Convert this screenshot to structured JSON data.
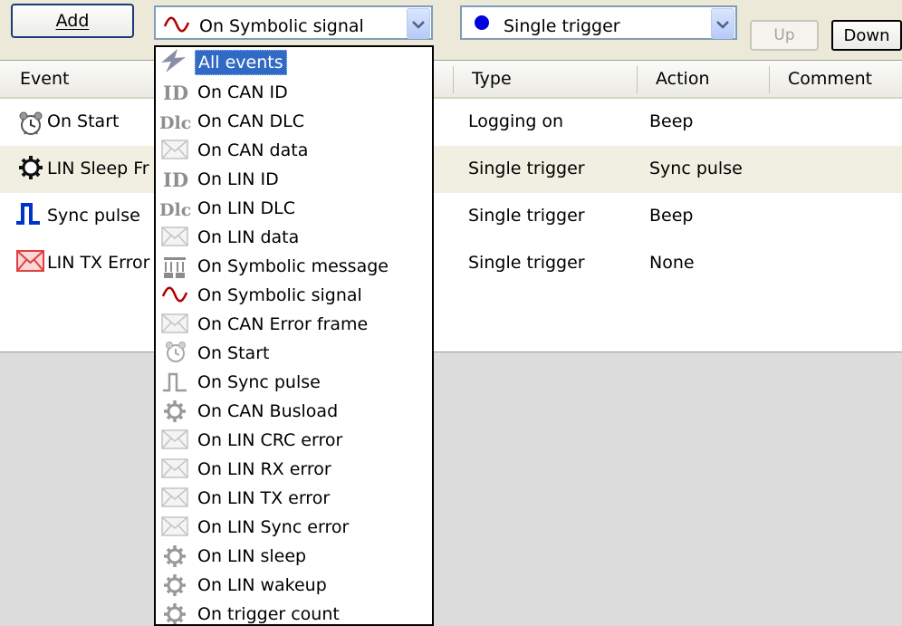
{
  "toolbar": {
    "add_label": "Add",
    "event_combo": {
      "selected": "On Symbolic signal",
      "icon": "sine-wave-icon"
    },
    "type_combo": {
      "selected": "Single trigger",
      "icon": "blue-dot-icon"
    },
    "up_label": "Up",
    "down_label": "Down"
  },
  "table": {
    "columns": {
      "event": "Event",
      "type": "Type",
      "action": "Action",
      "comment": "Comment"
    },
    "rows": [
      {
        "event": "On Start",
        "type": "Logging on",
        "action": "Beep",
        "comment": "",
        "icon": "alarm-clock-icon"
      },
      {
        "event": "LIN Sleep Fr",
        "type": "Single trigger",
        "action": "Sync pulse",
        "comment": "",
        "icon": "gear-icon"
      },
      {
        "event": "Sync pulse",
        "type": "Single trigger",
        "action": "Beep",
        "comment": "",
        "icon": "pulse-icon"
      },
      {
        "event": "LIN TX Error",
        "type": "Single trigger",
        "action": "None",
        "comment": "",
        "icon": "envelope-icon"
      }
    ]
  },
  "dropdown": {
    "items": [
      {
        "label": "All events",
        "icon": "lightning-icon",
        "selected": true
      },
      {
        "label": "On CAN ID",
        "icon": "id-icon"
      },
      {
        "label": "On CAN DLC",
        "icon": "dlc-icon"
      },
      {
        "label": "On CAN data",
        "icon": "envelope-icon"
      },
      {
        "label": "On LIN ID",
        "icon": "id-icon"
      },
      {
        "label": "On LIN DLC",
        "icon": "dlc-icon"
      },
      {
        "label": "On LIN data",
        "icon": "envelope-icon"
      },
      {
        "label": "On Symbolic message",
        "icon": "message-icon"
      },
      {
        "label": "On Symbolic signal",
        "icon": "sine-wave-icon"
      },
      {
        "label": "On CAN Error frame",
        "icon": "envelope-icon"
      },
      {
        "label": "On Start",
        "icon": "alarm-clock-icon"
      },
      {
        "label": "On Sync pulse",
        "icon": "pulse-icon"
      },
      {
        "label": "On CAN Busload",
        "icon": "gear-icon"
      },
      {
        "label": "On LIN CRC error",
        "icon": "envelope-icon"
      },
      {
        "label": "On LIN RX error",
        "icon": "envelope-icon"
      },
      {
        "label": "On LIN TX error",
        "icon": "envelope-icon"
      },
      {
        "label": "On LIN Sync error",
        "icon": "envelope-icon"
      },
      {
        "label": "On LIN sleep",
        "icon": "gear-icon"
      },
      {
        "label": "On LIN wakeup",
        "icon": "gear-icon"
      },
      {
        "label": "On trigger count",
        "icon": "gear-icon"
      }
    ]
  },
  "colors": {
    "selection": "#316ac5",
    "row_highlight": "#f1efe2",
    "signal_red": "#b00000",
    "dot_blue": "#0000e0",
    "pulse_blue": "#0033cc",
    "error_red": "#e04040"
  }
}
